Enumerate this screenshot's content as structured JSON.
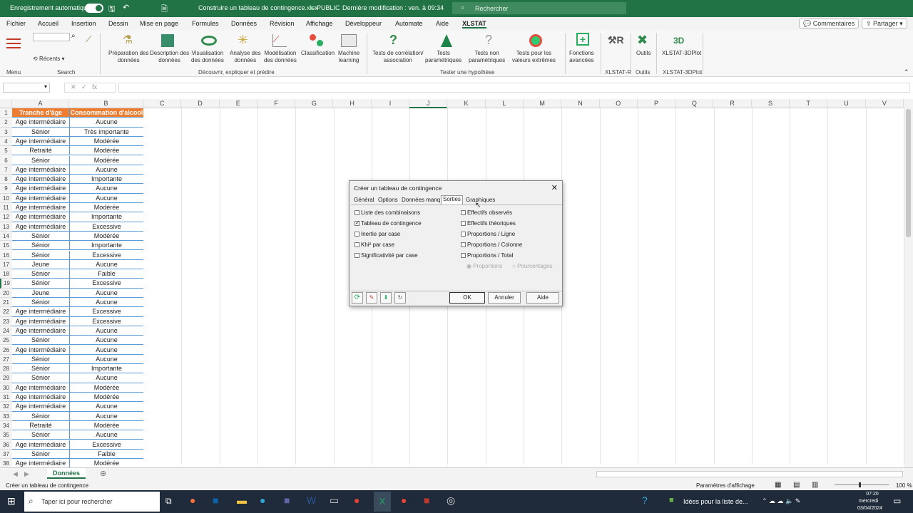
{
  "title_bar": {
    "autosave_label": "Enregistrement automatique",
    "file_title": "Construire un tableau de contingence.xlsx",
    "sensitivity": "PUBLIC",
    "last_modified": "Dernière modification : ven. à 09:34",
    "search_placeholder": "Rechercher"
  },
  "menu": {
    "items": [
      "Fichier",
      "Accueil",
      "Insertion",
      "Dessin",
      "Mise en page",
      "Formules",
      "Données",
      "Révision",
      "Affichage",
      "Développeur",
      "Automate",
      "Aide",
      "XLSTAT"
    ],
    "comments_btn": "Commentaires",
    "share_btn": "Partager"
  },
  "ribbon": {
    "menu_label": "Menu",
    "recents_label": "Récents",
    "search_group_label": "Search",
    "buttons": [
      {
        "label": "Préparation des\ndonnées"
      },
      {
        "label": "Description des\ndonnées"
      },
      {
        "label": "Visualisation\ndes données"
      },
      {
        "label": "Analyse des\ndonnées"
      },
      {
        "label": "Modélisation\ndes données"
      },
      {
        "label": "Classification"
      },
      {
        "label": "Machine\nlearning"
      },
      {
        "label": "Tests de corrélation/\nassociation"
      },
      {
        "label": "Tests\nparamétriques"
      },
      {
        "label": "Tests non\nparamétriques"
      },
      {
        "label": "Tests pour les\nvaleurs extrêmes"
      },
      {
        "label": "Fonctions\navancées"
      },
      {
        "label": "Outils"
      },
      {
        "label": "XLSTAT-3DPlot"
      }
    ],
    "groups": [
      "Découvrir, expliquer et prédire",
      "Tester une hypothèse",
      "XLSTAT-R",
      "Outils",
      "XLSTAT-3DPlot"
    ]
  },
  "formula_bar": {
    "fx": "fx"
  },
  "columns": [
    "A",
    "B",
    "C",
    "D",
    "E",
    "F",
    "G",
    "H",
    "I",
    "J",
    "K",
    "L",
    "M",
    "N",
    "O",
    "P",
    "Q",
    "R",
    "S",
    "T",
    "U",
    "V"
  ],
  "headers": [
    "Tranche d'âge",
    "Consommation d'alcool"
  ],
  "rows": [
    [
      "Age intermédiaire",
      "Aucune"
    ],
    [
      "Sénior",
      "Très importante"
    ],
    [
      "Age intermédiaire",
      "Modérée"
    ],
    [
      "Retraité",
      "Modérée"
    ],
    [
      "Sénior",
      "Modérée"
    ],
    [
      "Age intermédiaire",
      "Aucune"
    ],
    [
      "Age intermédiaire",
      "Importante"
    ],
    [
      "Age intermédiaire",
      "Aucune"
    ],
    [
      "Age intermédiaire",
      "Aucune"
    ],
    [
      "Age intermédiaire",
      "Modérée"
    ],
    [
      "Age intermédiaire",
      "Importante"
    ],
    [
      "Age intermédiaire",
      "Excessive"
    ],
    [
      "Sénior",
      "Modérée"
    ],
    [
      "Sénior",
      "Importante"
    ],
    [
      "Sénior",
      "Excessive"
    ],
    [
      "Jeune",
      "Aucune"
    ],
    [
      "Sénior",
      "Faible"
    ],
    [
      "Sénior",
      "Excessive"
    ],
    [
      "Jeune",
      "Aucune"
    ],
    [
      "Sénior",
      "Aucune"
    ],
    [
      "Age intermédiaire",
      "Excessive"
    ],
    [
      "Age intermédiaire",
      "Excessive"
    ],
    [
      "Age intermédiaire",
      "Aucune"
    ],
    [
      "Sénior",
      "Aucune"
    ],
    [
      "Age intermédiaire",
      "Aucune"
    ],
    [
      "Sénior",
      "Aucune"
    ],
    [
      "Sénior",
      "Importante"
    ],
    [
      "Sénior",
      "Aucune"
    ],
    [
      "Age intermédiaire",
      "Modérée"
    ],
    [
      "Age intermédiaire",
      "Modérée"
    ],
    [
      "Age intermédiaire",
      "Aucune"
    ],
    [
      "Sénior",
      "Aucune"
    ],
    [
      "Retraité",
      "Modérée"
    ],
    [
      "Sénior",
      "Aucune"
    ],
    [
      "Age intermédiaire",
      "Excessive"
    ],
    [
      "Sénior",
      "Faible"
    ],
    [
      "Age intermédiaire",
      "Modérée"
    ]
  ],
  "dialog": {
    "title": "Créer un tableau de contingence",
    "tabs": [
      "Général",
      "Options",
      "Données manq.",
      "Sorties",
      "Graphiques"
    ],
    "left_options": [
      {
        "label": "Liste des combinaisons",
        "checked": false
      },
      {
        "label": "Tableau de contingence",
        "checked": true
      },
      {
        "label": "Inertie par case",
        "checked": false
      },
      {
        "label": "Khi² par case",
        "checked": false
      },
      {
        "label": "Significativité par case",
        "checked": false
      }
    ],
    "right_options": [
      {
        "label": "Effectifs observés",
        "checked": false
      },
      {
        "label": "Effectifs théoriques",
        "checked": false
      },
      {
        "label": "Proportions / Ligne",
        "checked": false
      },
      {
        "label": "Proportions / Colonne",
        "checked": false
      },
      {
        "label": "Proportions / Total",
        "checked": false
      }
    ],
    "radio1": "Proportions",
    "radio2": "Pourcentages",
    "ok": "OK",
    "cancel": "Annuler",
    "help": "Aide"
  },
  "sheet_tab": "Données",
  "status": {
    "message": "Créer un tableau de contingence",
    "display_settings": "Paramètres d'affichage",
    "zoom": "100 %"
  },
  "taskbar": {
    "search_placeholder": "Taper ici pour rechercher",
    "news": "Idées pour la liste de...",
    "time": "07:20",
    "day": "mercredi",
    "date": "03/04/2024"
  }
}
